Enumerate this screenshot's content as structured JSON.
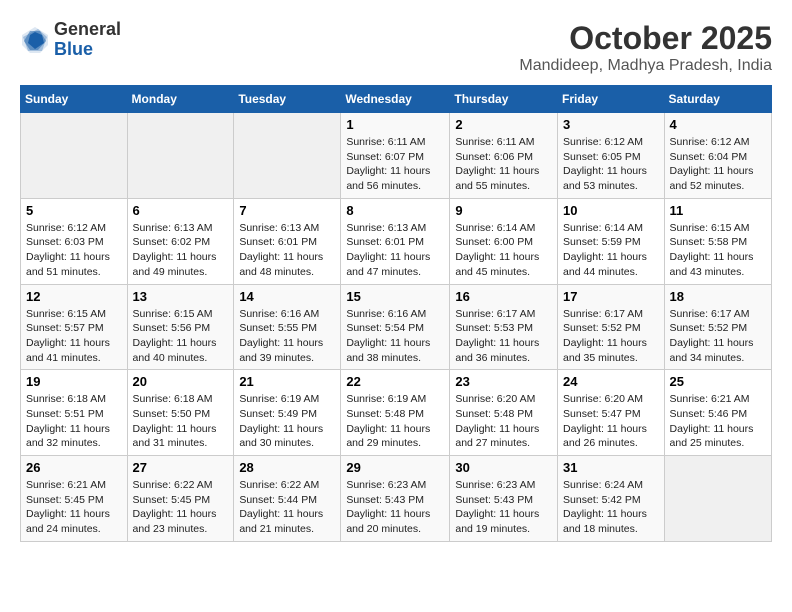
{
  "header": {
    "logo_general": "General",
    "logo_blue": "Blue",
    "month": "October 2025",
    "location": "Mandideep, Madhya Pradesh, India"
  },
  "weekdays": [
    "Sunday",
    "Monday",
    "Tuesday",
    "Wednesday",
    "Thursday",
    "Friday",
    "Saturday"
  ],
  "weeks": [
    [
      {
        "day": "",
        "info": ""
      },
      {
        "day": "",
        "info": ""
      },
      {
        "day": "",
        "info": ""
      },
      {
        "day": "1",
        "info": "Sunrise: 6:11 AM\nSunset: 6:07 PM\nDaylight: 11 hours\nand 56 minutes."
      },
      {
        "day": "2",
        "info": "Sunrise: 6:11 AM\nSunset: 6:06 PM\nDaylight: 11 hours\nand 55 minutes."
      },
      {
        "day": "3",
        "info": "Sunrise: 6:12 AM\nSunset: 6:05 PM\nDaylight: 11 hours\nand 53 minutes."
      },
      {
        "day": "4",
        "info": "Sunrise: 6:12 AM\nSunset: 6:04 PM\nDaylight: 11 hours\nand 52 minutes."
      }
    ],
    [
      {
        "day": "5",
        "info": "Sunrise: 6:12 AM\nSunset: 6:03 PM\nDaylight: 11 hours\nand 51 minutes."
      },
      {
        "day": "6",
        "info": "Sunrise: 6:13 AM\nSunset: 6:02 PM\nDaylight: 11 hours\nand 49 minutes."
      },
      {
        "day": "7",
        "info": "Sunrise: 6:13 AM\nSunset: 6:01 PM\nDaylight: 11 hours\nand 48 minutes."
      },
      {
        "day": "8",
        "info": "Sunrise: 6:13 AM\nSunset: 6:01 PM\nDaylight: 11 hours\nand 47 minutes."
      },
      {
        "day": "9",
        "info": "Sunrise: 6:14 AM\nSunset: 6:00 PM\nDaylight: 11 hours\nand 45 minutes."
      },
      {
        "day": "10",
        "info": "Sunrise: 6:14 AM\nSunset: 5:59 PM\nDaylight: 11 hours\nand 44 minutes."
      },
      {
        "day": "11",
        "info": "Sunrise: 6:15 AM\nSunset: 5:58 PM\nDaylight: 11 hours\nand 43 minutes."
      }
    ],
    [
      {
        "day": "12",
        "info": "Sunrise: 6:15 AM\nSunset: 5:57 PM\nDaylight: 11 hours\nand 41 minutes."
      },
      {
        "day": "13",
        "info": "Sunrise: 6:15 AM\nSunset: 5:56 PM\nDaylight: 11 hours\nand 40 minutes."
      },
      {
        "day": "14",
        "info": "Sunrise: 6:16 AM\nSunset: 5:55 PM\nDaylight: 11 hours\nand 39 minutes."
      },
      {
        "day": "15",
        "info": "Sunrise: 6:16 AM\nSunset: 5:54 PM\nDaylight: 11 hours\nand 38 minutes."
      },
      {
        "day": "16",
        "info": "Sunrise: 6:17 AM\nSunset: 5:53 PM\nDaylight: 11 hours\nand 36 minutes."
      },
      {
        "day": "17",
        "info": "Sunrise: 6:17 AM\nSunset: 5:52 PM\nDaylight: 11 hours\nand 35 minutes."
      },
      {
        "day": "18",
        "info": "Sunrise: 6:17 AM\nSunset: 5:52 PM\nDaylight: 11 hours\nand 34 minutes."
      }
    ],
    [
      {
        "day": "19",
        "info": "Sunrise: 6:18 AM\nSunset: 5:51 PM\nDaylight: 11 hours\nand 32 minutes."
      },
      {
        "day": "20",
        "info": "Sunrise: 6:18 AM\nSunset: 5:50 PM\nDaylight: 11 hours\nand 31 minutes."
      },
      {
        "day": "21",
        "info": "Sunrise: 6:19 AM\nSunset: 5:49 PM\nDaylight: 11 hours\nand 30 minutes."
      },
      {
        "day": "22",
        "info": "Sunrise: 6:19 AM\nSunset: 5:48 PM\nDaylight: 11 hours\nand 29 minutes."
      },
      {
        "day": "23",
        "info": "Sunrise: 6:20 AM\nSunset: 5:48 PM\nDaylight: 11 hours\nand 27 minutes."
      },
      {
        "day": "24",
        "info": "Sunrise: 6:20 AM\nSunset: 5:47 PM\nDaylight: 11 hours\nand 26 minutes."
      },
      {
        "day": "25",
        "info": "Sunrise: 6:21 AM\nSunset: 5:46 PM\nDaylight: 11 hours\nand 25 minutes."
      }
    ],
    [
      {
        "day": "26",
        "info": "Sunrise: 6:21 AM\nSunset: 5:45 PM\nDaylight: 11 hours\nand 24 minutes."
      },
      {
        "day": "27",
        "info": "Sunrise: 6:22 AM\nSunset: 5:45 PM\nDaylight: 11 hours\nand 23 minutes."
      },
      {
        "day": "28",
        "info": "Sunrise: 6:22 AM\nSunset: 5:44 PM\nDaylight: 11 hours\nand 21 minutes."
      },
      {
        "day": "29",
        "info": "Sunrise: 6:23 AM\nSunset: 5:43 PM\nDaylight: 11 hours\nand 20 minutes."
      },
      {
        "day": "30",
        "info": "Sunrise: 6:23 AM\nSunset: 5:43 PM\nDaylight: 11 hours\nand 19 minutes."
      },
      {
        "day": "31",
        "info": "Sunrise: 6:24 AM\nSunset: 5:42 PM\nDaylight: 11 hours\nand 18 minutes."
      },
      {
        "day": "",
        "info": ""
      }
    ]
  ]
}
